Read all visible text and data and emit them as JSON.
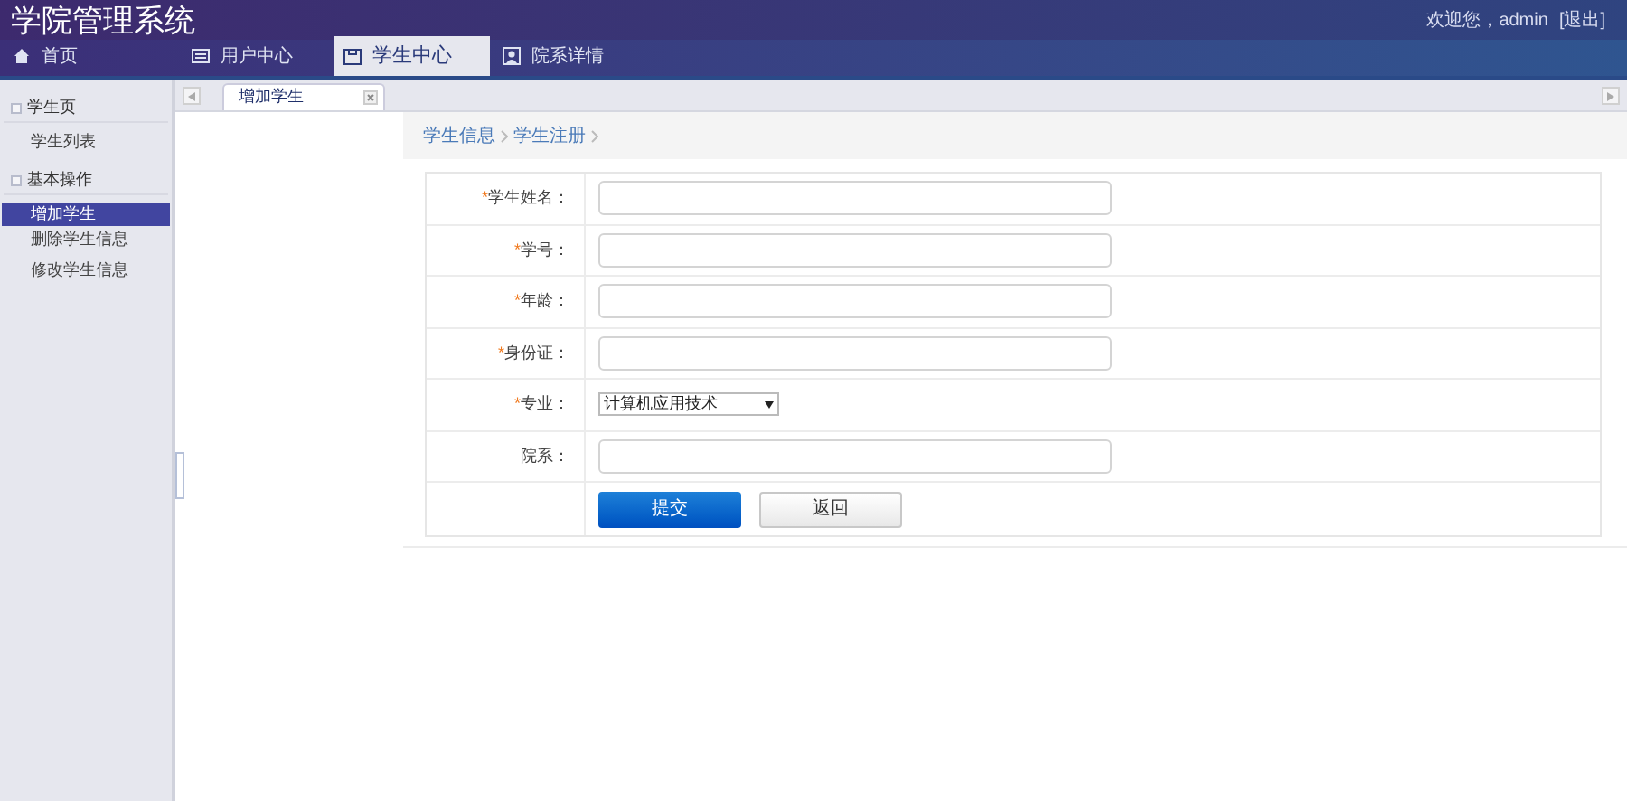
{
  "header": {
    "title": "学院管理系统",
    "welcome": "欢迎您，admin",
    "logout": "[退出]"
  },
  "nav_tabs": [
    {
      "label": "首页",
      "kind": "home",
      "selected": false
    },
    {
      "label": "用户中心",
      "kind": "list",
      "selected": false
    },
    {
      "label": "学生中心",
      "kind": "window",
      "selected": true
    },
    {
      "label": "院系详情",
      "kind": "person",
      "selected": false
    }
  ],
  "sidebar": {
    "groups": [
      {
        "title": "学生页",
        "items": [
          {
            "label": "学生列表",
            "selected": false
          }
        ]
      },
      {
        "title": "基本操作",
        "items": [
          {
            "label": "增加学生",
            "selected": true
          },
          {
            "label": "删除学生信息",
            "selected": false
          },
          {
            "label": "修改学生信息",
            "selected": false
          }
        ]
      }
    ]
  },
  "page_tabs": [
    {
      "label": "增加学生",
      "selected": true
    }
  ],
  "breadcrumb": [
    "学生信息",
    "学生注册"
  ],
  "form": {
    "fields": [
      {
        "required_mark": "*",
        "label": "学生姓名：",
        "kind": "text"
      },
      {
        "required_mark": "*",
        "label": "学号：",
        "kind": "text"
      },
      {
        "required_mark": "*",
        "label": "年龄：",
        "kind": "text"
      },
      {
        "required_mark": "*",
        "label": "身份证：",
        "kind": "text"
      },
      {
        "required_mark": "*",
        "label": "专业：",
        "kind": "select",
        "value": "计算机应用技术"
      },
      {
        "label": "院系：",
        "kind": "text"
      }
    ],
    "buttons": [
      {
        "label": "提交",
        "kind": "primary"
      },
      {
        "label": "返回",
        "kind": "secondary"
      }
    ]
  }
}
